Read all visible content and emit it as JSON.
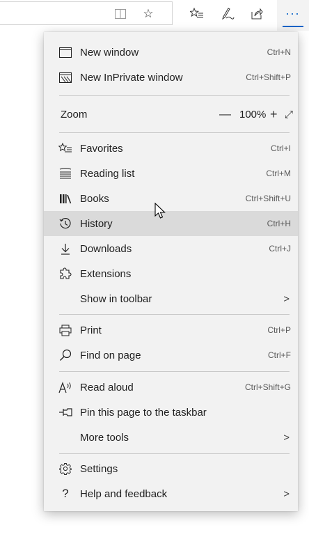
{
  "toolbar": {
    "icons": [
      "reading-view-icon",
      "favorite-star-icon",
      "favorites-list-icon",
      "pen-icon",
      "share-icon",
      "more-icon"
    ],
    "more_label": "···",
    "accent": "#0a64c8"
  },
  "menu": {
    "items": [
      {
        "label": "New window",
        "shortcut": "Ctrl+N",
        "icon": "window-icon"
      },
      {
        "label": "New InPrivate window",
        "shortcut": "Ctrl+Shift+P",
        "icon": "inprivate-icon"
      },
      {
        "label": "Favorites",
        "shortcut": "Ctrl+I",
        "icon": "favorites-icon"
      },
      {
        "label": "Reading list",
        "shortcut": "Ctrl+M",
        "icon": "reading-list-icon"
      },
      {
        "label": "Books",
        "shortcut": "Ctrl+Shift+U",
        "icon": "books-icon"
      },
      {
        "label": "History",
        "shortcut": "Ctrl+H",
        "icon": "history-icon"
      },
      {
        "label": "Downloads",
        "shortcut": "Ctrl+J",
        "icon": "download-icon"
      },
      {
        "label": "Extensions",
        "shortcut": "",
        "icon": "extensions-icon"
      },
      {
        "label": "Show in toolbar",
        "chevron": ">"
      },
      {
        "label": "Print",
        "shortcut": "Ctrl+P",
        "icon": "print-icon"
      },
      {
        "label": "Find on page",
        "shortcut": "Ctrl+F",
        "icon": "search-icon"
      },
      {
        "label": "Read aloud",
        "shortcut": "Ctrl+Shift+G",
        "icon": "read-aloud-icon"
      },
      {
        "label": "Pin this page to the taskbar",
        "shortcut": "",
        "icon": "pin-icon"
      },
      {
        "label": "More tools",
        "chevron": ">"
      },
      {
        "label": "Settings",
        "shortcut": "",
        "icon": "settings-icon"
      },
      {
        "label": "Help and feedback",
        "chevron": ">",
        "icon": "help-icon"
      }
    ],
    "zoom": {
      "label": "Zoom",
      "minus": "—",
      "value": "100%",
      "plus": "+",
      "expand": "⤢"
    },
    "hover_item": "History"
  }
}
